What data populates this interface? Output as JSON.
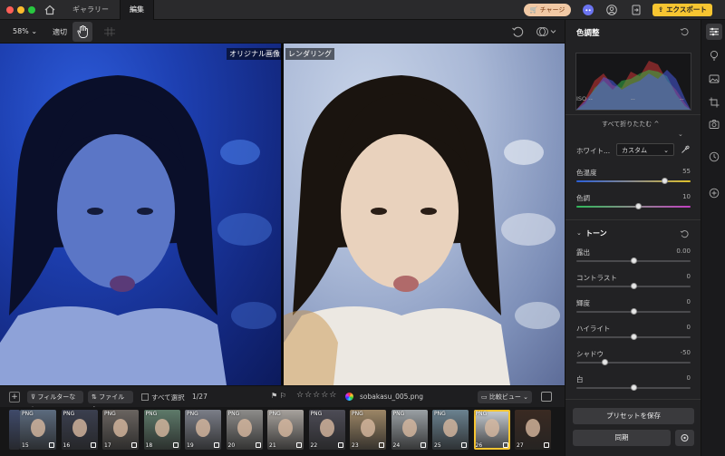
{
  "titlebar": {
    "tabs": [
      "ギャラリー",
      "編集"
    ],
    "charge_label": "チャージ",
    "export_label": "エクスポート"
  },
  "toolbar": {
    "zoom": "58%",
    "fit_label": "適切"
  },
  "image": {
    "label_original": "オリジナル画像",
    "label_render": "レンダリング"
  },
  "strip_bar": {
    "filter_label": "フィルターなし",
    "file_label": "ファイル名",
    "select_all_label": "すべて選択",
    "count": "1/27",
    "stars": "☆☆☆☆☆",
    "filename": "sobakasu_005.png",
    "compare_view_label": "比較ビュー"
  },
  "filmstrip": {
    "thumbs": [
      {
        "num": "",
        "fmt": "",
        "color": "#3f4a6a"
      },
      {
        "num": "15",
        "fmt": "PNG",
        "color": "#5c6b7e"
      },
      {
        "num": "16",
        "fmt": "PNG",
        "color": "#3b3f4f"
      },
      {
        "num": "17",
        "fmt": "PNG",
        "color": "#6a6460"
      },
      {
        "num": "18",
        "fmt": "PNG",
        "color": "#5e7a6a"
      },
      {
        "num": "19",
        "fmt": "PNG",
        "color": "#7b7e88"
      },
      {
        "num": "20",
        "fmt": "PNG",
        "color": "#8d8c8a"
      },
      {
        "num": "21",
        "fmt": "PNG",
        "color": "#a7a29d"
      },
      {
        "num": "22",
        "fmt": "PNG",
        "color": "#4d4c56"
      },
      {
        "num": "23",
        "fmt": "PNG",
        "color": "#9c8666"
      },
      {
        "num": "24",
        "fmt": "PNG",
        "color": "#9aa0a4"
      },
      {
        "num": "25",
        "fmt": "PNG",
        "color": "#6b8290"
      },
      {
        "num": "26",
        "fmt": "PNG",
        "color": "#c8ced4"
      },
      {
        "num": "27",
        "fmt": "",
        "color": "#3a2a22"
      }
    ],
    "selected_index": 12
  },
  "panel": {
    "title": "色調整",
    "iso": "ISO --",
    "iso_mid": "--",
    "iso_right": "--",
    "collapse_all": "すべて折りたたむ ^",
    "wb_label": "ホワイト...",
    "wb_value": "カスタム",
    "sliders_wb": [
      {
        "label": "色温度",
        "value": "55",
        "pos": 0.775,
        "kind": "temp"
      },
      {
        "label": "色調",
        "value": "10",
        "pos": 0.545,
        "kind": "tint"
      }
    ],
    "tone_title": "トーン",
    "sliders_tone": [
      {
        "label": "露出",
        "value": "0.00",
        "pos": 0.5
      },
      {
        "label": "コントラスト",
        "value": "0",
        "pos": 0.5
      },
      {
        "label": "輝度",
        "value": "0",
        "pos": 0.5
      },
      {
        "label": "ハイライト",
        "value": "0",
        "pos": 0.5
      },
      {
        "label": "シャドウ",
        "value": "-50",
        "pos": 0.25
      },
      {
        "label": "白",
        "value": "0",
        "pos": 0.5
      }
    ],
    "preset_label": "プリセットを保存",
    "sync_label": "同期"
  }
}
